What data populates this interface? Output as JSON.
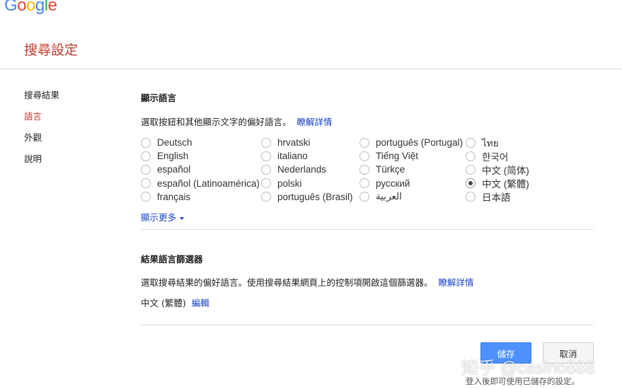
{
  "logo": {
    "letters": [
      "G",
      "o",
      "o",
      "g",
      "l",
      "e"
    ],
    "colors": [
      "#4285f4",
      "#ea4335",
      "#fbbc05",
      "#4285f4",
      "#34a853",
      "#ea4335"
    ]
  },
  "page_title": "搜尋設定",
  "sidebar": {
    "items": [
      {
        "label": "搜尋結果",
        "active": false
      },
      {
        "label": "語言",
        "active": true
      },
      {
        "label": "外觀",
        "active": false
      },
      {
        "label": "說明",
        "active": false
      }
    ]
  },
  "display_language": {
    "title": "顯示語言",
    "description": "選取按鈕和其他顯示文字的偏好語言。",
    "learn_more": "瞭解詳情",
    "columns": [
      [
        "Deutsch",
        "English",
        "español",
        "español (Latinoamérica)",
        "français"
      ],
      [
        "hrvatski",
        "italiano",
        "Nederlands",
        "polski",
        "português (Brasil)"
      ],
      [
        "português (Portugal)",
        "Tiếng Việt",
        "Türkçe",
        "русский",
        "العربية"
      ],
      [
        "ไทย",
        "한국어",
        "中文 (简体)",
        "中文 (繁體)",
        "日本語"
      ]
    ],
    "selected": "中文 (繁體)",
    "show_more": "顯示更多"
  },
  "results_filter": {
    "title": "結果語言篩選器",
    "description": "選取搜尋結果的偏好語言。使用搜尋結果網頁上的控制項開啟這個篩選器。",
    "learn_more": "瞭解詳情",
    "current_value": "中文 (繁體)",
    "edit": "編輯"
  },
  "actions": {
    "save": "儲存",
    "cancel": "取消",
    "footnote": "登入後即可使用已儲存的設定。"
  },
  "watermark": "知乎 @casino888",
  "colors": {
    "accent_red": "#c5392c",
    "link_blue": "#1a44c4",
    "save_blue": "#4d90fe"
  }
}
